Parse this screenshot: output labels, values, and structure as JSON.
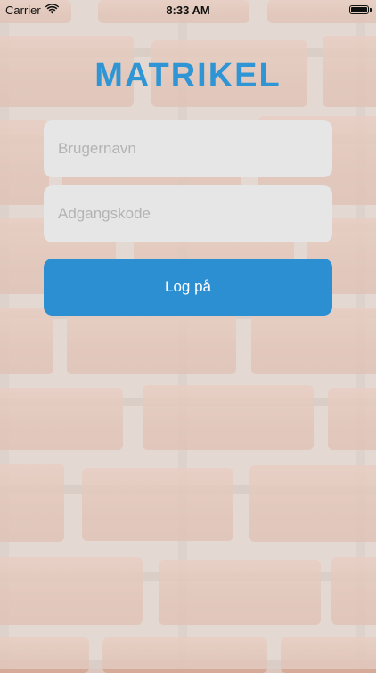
{
  "status_bar": {
    "carrier": "Carrier",
    "time": "8:33 AM",
    "wifi_icon": "wifi-icon",
    "battery_icon": "battery-icon"
  },
  "app": {
    "title": "MATRIKEL",
    "title_color": "#2f95d4"
  },
  "login_form": {
    "username_placeholder": "Brugernavn",
    "username_value": "",
    "password_placeholder": "Adgangskode",
    "password_value": "",
    "submit_label": "Log på",
    "submit_color": "#2b8fd1"
  },
  "background": {
    "type": "brick-wall"
  }
}
